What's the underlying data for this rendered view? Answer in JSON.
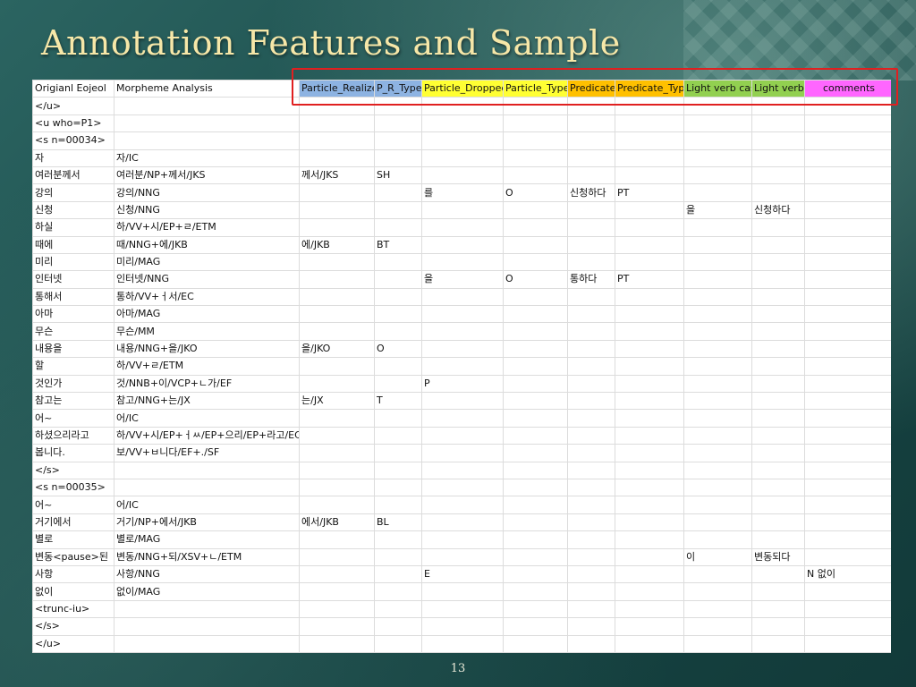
{
  "slide": {
    "title": "Annotation Features and Sample",
    "page_number": "13"
  },
  "colors": {
    "particle_realized_header": "#8db3e2",
    "particle_dropped_header": "#ffff33",
    "predicate_header": "#ffc000",
    "light_verb_header": "#92d050",
    "comments_header": "#ff66ff",
    "highlight_box": "#e02020"
  },
  "table": {
    "headers": [
      "Origianl Eojeol",
      "Morpheme Analysis",
      "Particle_Realized",
      "P_R_Type",
      "Particle_Dropped",
      "Particle_Type",
      "Predicate",
      "Predicate_Type",
      "Light verb case",
      "Light verb",
      "comments"
    ],
    "rows": [
      [
        "</u>",
        "",
        "",
        "",
        "",
        "",
        "",
        "",
        "",
        "",
        ""
      ],
      [
        "<u who=P1>",
        "",
        "",
        "",
        "",
        "",
        "",
        "",
        "",
        "",
        ""
      ],
      [
        "<s n=00034>",
        "",
        "",
        "",
        "",
        "",
        "",
        "",
        "",
        "",
        ""
      ],
      [
        "자",
        "자/IC",
        "",
        "",
        "",
        "",
        "",
        "",
        "",
        "",
        ""
      ],
      [
        "여러분께서",
        "여러분/NP+께서/JKS",
        "께서/JKS",
        "SH",
        "",
        "",
        "",
        "",
        "",
        "",
        ""
      ],
      [
        "강의",
        "강의/NNG",
        "",
        "",
        "를",
        "O",
        "신청하다",
        "PT",
        "",
        "",
        ""
      ],
      [
        "신청",
        "신청/NNG",
        "",
        "",
        "",
        "",
        "",
        "",
        "을",
        "신청하다",
        ""
      ],
      [
        "하실",
        "하/VV+시/EP+ㄹ/ETM",
        "",
        "",
        "",
        "",
        "",
        "",
        "",
        "",
        ""
      ],
      [
        "때에",
        "때/NNG+에/JKB",
        "에/JKB",
        "BT",
        "",
        "",
        "",
        "",
        "",
        "",
        ""
      ],
      [
        "미리",
        "미리/MAG",
        "",
        "",
        "",
        "",
        "",
        "",
        "",
        "",
        ""
      ],
      [
        "인터넷",
        "인터넷/NNG",
        "",
        "",
        "을",
        "O",
        "통하다",
        "PT",
        "",
        "",
        ""
      ],
      [
        "통해서",
        "통하/VV+ㅓ서/EC",
        "",
        "",
        "",
        "",
        "",
        "",
        "",
        "",
        ""
      ],
      [
        "아마",
        "아마/MAG",
        "",
        "",
        "",
        "",
        "",
        "",
        "",
        "",
        ""
      ],
      [
        "무슨",
        "무슨/MM",
        "",
        "",
        "",
        "",
        "",
        "",
        "",
        "",
        ""
      ],
      [
        "내용을",
        "내용/NNG+을/JKO",
        "을/JKO",
        "O",
        "",
        "",
        "",
        "",
        "",
        "",
        ""
      ],
      [
        "할",
        "하/VV+ㄹ/ETM",
        "",
        "",
        "",
        "",
        "",
        "",
        "",
        "",
        ""
      ],
      [
        "것인가",
        "것/NNB+이/VCP+ㄴ가/EF",
        "",
        "",
        "P",
        "",
        "",
        "",
        "",
        "",
        ""
      ],
      [
        "참고는",
        "참고/NNG+는/JX",
        "는/JX",
        "T",
        "",
        "",
        "",
        "",
        "",
        "",
        ""
      ],
      [
        "어~",
        "어/IC",
        "",
        "",
        "",
        "",
        "",
        "",
        "",
        "",
        ""
      ],
      [
        "하셨으리라고",
        "하/VV+시/EP+ㅓㅆ/EP+으리/EP+라고/EC",
        "",
        "",
        "",
        "",
        "",
        "",
        "",
        "",
        ""
      ],
      [
        "봅니다.",
        "보/VV+ㅂ니다/EF+./SF",
        "",
        "",
        "",
        "",
        "",
        "",
        "",
        "",
        ""
      ],
      [
        "</s>",
        "",
        "",
        "",
        "",
        "",
        "",
        "",
        "",
        "",
        ""
      ],
      [
        "<s n=00035>",
        "",
        "",
        "",
        "",
        "",
        "",
        "",
        "",
        "",
        ""
      ],
      [
        "어~",
        "어/IC",
        "",
        "",
        "",
        "",
        "",
        "",
        "",
        "",
        ""
      ],
      [
        "거기에서",
        "거기/NP+에서/JKB",
        "에서/JKB",
        "BL",
        "",
        "",
        "",
        "",
        "",
        "",
        ""
      ],
      [
        "별로",
        "별로/MAG",
        "",
        "",
        "",
        "",
        "",
        "",
        "",
        "",
        ""
      ],
      [
        "변동<pause>된",
        "변동/NNG+되/XSV+ㄴ/ETM",
        "",
        "",
        "",
        "",
        "",
        "",
        "이",
        "변동되다",
        ""
      ],
      [
        "사항",
        "사항/NNG",
        "",
        "",
        "E",
        "",
        "",
        "",
        "",
        "",
        "N 없이"
      ],
      [
        "없이",
        "없이/MAG",
        "",
        "",
        "",
        "",
        "",
        "",
        "",
        "",
        ""
      ],
      [
        "<trunc-iu>",
        "",
        "",
        "",
        "",
        "",
        "",
        "",
        "",
        "",
        ""
      ],
      [
        "</s>",
        "",
        "",
        "",
        "",
        "",
        "",
        "",
        "",
        "",
        ""
      ],
      [
        "</u>",
        "",
        "",
        "",
        "",
        "",
        "",
        "",
        "",
        "",
        ""
      ]
    ]
  }
}
